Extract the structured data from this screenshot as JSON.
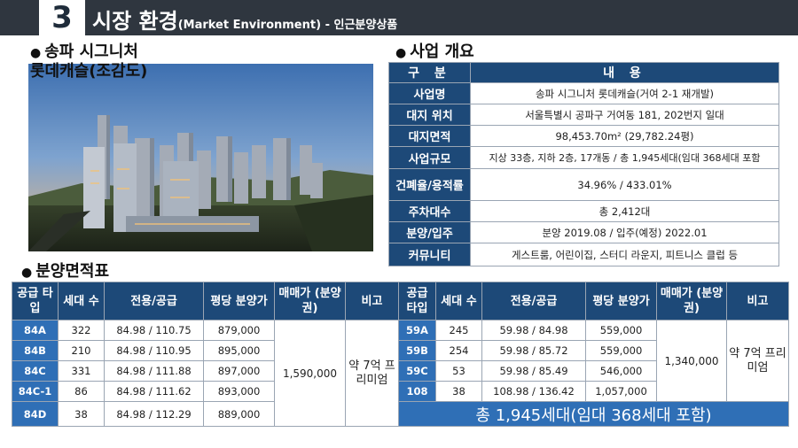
{
  "header": {
    "number": "3",
    "title": "시장 환경",
    "subtitle": "(Market Environment) - 인근분양상품"
  },
  "left_section": {
    "title": "송파 시그니처",
    "caption": "롯데캐슬(조감도)"
  },
  "overview": {
    "title": "사업 개요",
    "head": {
      "col1": "구 분",
      "col2": "내 용"
    },
    "rows": [
      {
        "label": "사업명",
        "value": "송파 시그니처 롯데캐슬(거여 2-1 재개발)"
      },
      {
        "label": "대지 위치",
        "value": "서울특별시 공파구 거여동 181, 202번지 일대"
      },
      {
        "label": "대지면적",
        "value": "98,453.70m² (29,782.24평)"
      },
      {
        "label": "사업규모",
        "value": "지상 33층, 지하 2층, 17개동 / 총 1,945세대(임대 368세대 포함"
      },
      {
        "label": "건폐율/용적률",
        "value": "34.96% / 433.01%"
      },
      {
        "label": "주차대수",
        "value": "총 2,412대"
      },
      {
        "label": "분양/입주",
        "value": "분양 2019.08 / 입주(예정) 2022.01"
      },
      {
        "label": "커뮤니티",
        "value": "게스트룸, 어린이집, 스터디 라운지, 피트니스 클럽 등"
      }
    ]
  },
  "area_table": {
    "title": "분양면적표",
    "headers": {
      "type": "공급 타입",
      "units": "세대 수",
      "area": "전용/공급",
      "price": "평당 분양가",
      "sale": "매매가 (분양권)",
      "note": "비고"
    },
    "left": {
      "rows": [
        {
          "type": "84A",
          "units": "322",
          "area": "84.98 / 110.75",
          "price": "879,000"
        },
        {
          "type": "84B",
          "units": "210",
          "area": "84.98 / 110.95",
          "price": "895,000"
        },
        {
          "type": "84C",
          "units": "331",
          "area": "84.98 / 111.88",
          "price": "897,000"
        },
        {
          "type": "84C-1",
          "units": "86",
          "area": "84.98 / 111.62",
          "price": "893,000"
        },
        {
          "type": "84D",
          "units": "38",
          "area": "84.98 / 112.29",
          "price": "889,000"
        }
      ],
      "sale": "1,590,000",
      "note": "약 7억 프리미엄"
    },
    "right": {
      "rows": [
        {
          "type": "59A",
          "units": "245",
          "area": "59.98 / 84.98",
          "price": "559,000"
        },
        {
          "type": "59B",
          "units": "254",
          "area": "59.98 / 85.72",
          "price": "559,000"
        },
        {
          "type": "59C",
          "units": "53",
          "area": "59.98 / 85.49",
          "price": "546,000"
        },
        {
          "type": "108",
          "units": "38",
          "area": "108.98 / 136.42",
          "price": "1,057,000"
        }
      ],
      "sale": "1,340,000",
      "note": "약 7억 프리미엄"
    },
    "total": "총 1,945세대(임대 368세대 포함)"
  },
  "colors": {
    "header_bg": "#2f363f",
    "table_header": "#1d4978",
    "type_cell": "#2f6fb6"
  }
}
